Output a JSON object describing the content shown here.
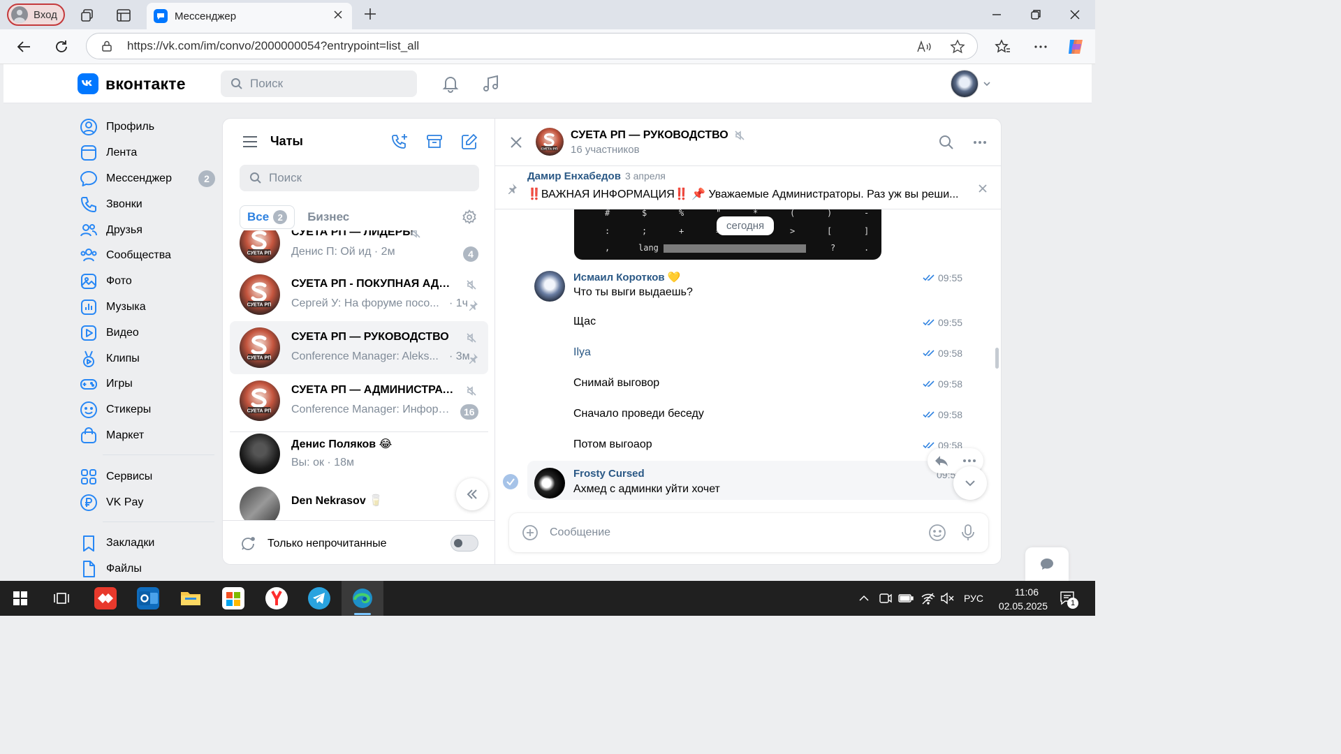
{
  "browser": {
    "login_label": "Вход",
    "tab_title": "Мессенджер",
    "url": "https://vk.com/im/convo/2000000054?entrypoint=list_all"
  },
  "vk_header": {
    "logo_text": "вконтакте",
    "search_placeholder": "Поиск"
  },
  "left_nav": {
    "items": [
      {
        "label": "Профиль",
        "icon": "profile-icon"
      },
      {
        "label": "Лента",
        "icon": "feed-icon"
      },
      {
        "label": "Мессенджер",
        "icon": "messenger-icon",
        "badge": "2"
      },
      {
        "label": "Звонки",
        "icon": "phone-icon"
      },
      {
        "label": "Друзья",
        "icon": "friends-icon"
      },
      {
        "label": "Сообщества",
        "icon": "communities-icon"
      },
      {
        "label": "Фото",
        "icon": "photo-icon"
      },
      {
        "label": "Музыка",
        "icon": "music-icon"
      },
      {
        "label": "Видео",
        "icon": "video-icon"
      },
      {
        "label": "Клипы",
        "icon": "clips-icon"
      },
      {
        "label": "Игры",
        "icon": "games-icon"
      },
      {
        "label": "Стикеры",
        "icon": "stickers-icon"
      },
      {
        "label": "Маркет",
        "icon": "market-icon"
      }
    ],
    "items2": [
      {
        "label": "Сервисы",
        "icon": "services-icon"
      },
      {
        "label": "VK Pay",
        "icon": "vkpay-icon"
      }
    ],
    "items3": [
      {
        "label": "Закладки",
        "icon": "bookmarks-icon"
      },
      {
        "label": "Файлы",
        "icon": "files-icon"
      }
    ]
  },
  "chat_list": {
    "title": "Чаты",
    "search_placeholder": "Поиск",
    "filter_all": "Все",
    "filter_all_count": "2",
    "filter_business": "Бизнес",
    "chats": [
      {
        "name": "СУЕТА РП — ЛИДЕРЫ",
        "preview": "Денис П: Ой ид · 2м",
        "unread": "4",
        "muted": true
      },
      {
        "name": "СУЕТА РП - ПОКУПНАЯ АДМИ...",
        "preview": "Сергей У: На форуме посо...",
        "time": "· 1ч",
        "muted": true,
        "pinned": true
      },
      {
        "name": "СУЕТА РП — РУКОВОДСТВО",
        "preview": "Conference Manager: Aleks...",
        "time": "· 3м",
        "muted": true,
        "pinned": true
      },
      {
        "name": "СУЕТА РП — АДМИНИСТРАТО...",
        "preview": "Conference Manager: Информ...",
        "unread": "16",
        "muted": true
      },
      {
        "name": "Денис Поляков 😂",
        "preview": "Вы: ок · 18м"
      },
      {
        "name": "Den Nekrasov 🥛",
        "preview": ""
      }
    ],
    "unread_only_label": "Только непрочитанные"
  },
  "conversation": {
    "title": "СУЕТА РП — РУКОВОДСТВО",
    "subtitle": "16 участников",
    "pinned_author": "Дамир Енхабедов",
    "pinned_date": "3 апреля",
    "pinned_text": "‼️ВАЖНАЯ ИНФОРМАЦИЯ‼️ 📌 Уважаемые Администраторы. Раз уж вы реши...",
    "date_divider": "сегодня",
    "keyboard_keys": [
      "#",
      "$",
      "%",
      "\"",
      "*",
      "(",
      ")",
      "-",
      ":",
      ";",
      "+",
      "=",
      ">",
      "[",
      "]",
      ",",
      "lang",
      "?",
      "."
    ],
    "messages": [
      {
        "author": "Исмаил Коротков 💛",
        "text": "Что ты выги выдаешь?",
        "time": "09:55"
      },
      {
        "text": "Щас",
        "time": "09:55"
      },
      {
        "text": "Ilya",
        "time": "09:58",
        "link": true
      },
      {
        "text": "Снимай выговор",
        "time": "09:58"
      },
      {
        "text": "Сначало проведи беседу",
        "time": "09:58"
      },
      {
        "text": "Потом выгоаор",
        "time": "09:58"
      },
      {
        "author": "Frosty Cursed",
        "text": "Ахмед с админки уйти хочет",
        "time": "09:5"
      }
    ],
    "composer_placeholder": "Сообщение"
  },
  "taskbar": {
    "language": "РУС",
    "time": "11:06",
    "date": "02.05.2025",
    "notification_count": "1"
  },
  "colors": {
    "vk_blue": "#0077ff",
    "link_blue": "#2a5885",
    "badge_gray": "#aeb7c2",
    "taskbar": "#202020"
  }
}
